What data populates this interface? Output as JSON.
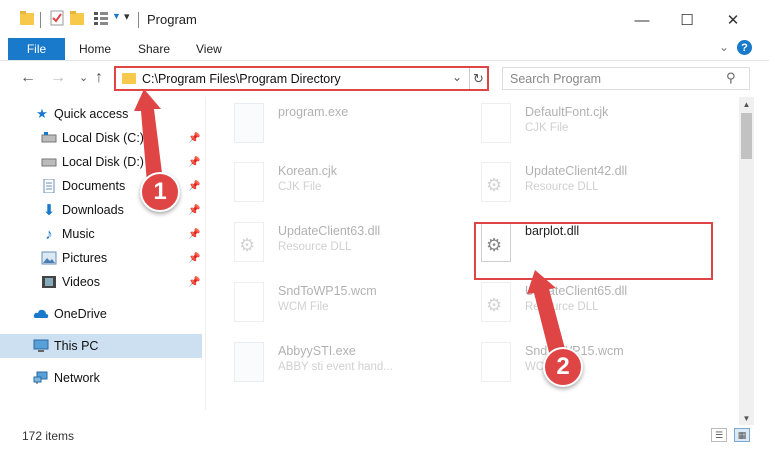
{
  "window": {
    "title": "Program",
    "minimize": "—",
    "maximize": "☐",
    "close": "✕"
  },
  "ribbon": {
    "tabs": [
      "File",
      "Home",
      "Share",
      "View"
    ],
    "collapse": "⌄",
    "help": "?"
  },
  "nav": {
    "back": "←",
    "forward": "→",
    "recent": "⌄",
    "up": "↑",
    "address": "C:\\Program Files\\Program Directory",
    "address_dropdown": "⌄",
    "refresh": "↻",
    "search_placeholder": "Search Program",
    "search_icon": "⚲"
  },
  "sidebar": {
    "items": [
      {
        "label": "Quick access",
        "icon": "star-icon"
      },
      {
        "label": "Local Disk (C:)",
        "icon": "drive-icon"
      },
      {
        "label": "Local Disk (D:)",
        "icon": "drive-icon"
      },
      {
        "label": "Documents",
        "icon": "documents-icon"
      },
      {
        "label": "Downloads",
        "icon": "download-icon"
      },
      {
        "label": "Music",
        "icon": "music-icon"
      },
      {
        "label": "Pictures",
        "icon": "pictures-icon"
      },
      {
        "label": "Videos",
        "icon": "videos-icon"
      },
      {
        "label": "OneDrive",
        "icon": "cloud-icon"
      },
      {
        "label": "This PC",
        "icon": "computer-icon"
      },
      {
        "label": "Network",
        "icon": "network-icon"
      }
    ]
  },
  "files": [
    {
      "name": "program.exe",
      "type": ""
    },
    {
      "name": "DefaultFont.cjk",
      "type": "CJK File"
    },
    {
      "name": "Korean.cjk",
      "type": "CJK File"
    },
    {
      "name": "UpdateClient42.dll",
      "type": "Resource DLL"
    },
    {
      "name": "UpdateClient63.dll",
      "type": "Resource DLL"
    },
    {
      "name": "barplot.dll",
      "type": ""
    },
    {
      "name": "SndToWP15.wcm",
      "type": "WCM File"
    },
    {
      "name": "UpdateClient65.dll",
      "type": "Resource DLL"
    },
    {
      "name": "AbbyySTI.exe",
      "type": "ABBY sti event hand..."
    },
    {
      "name": "SndToWP15.wcm",
      "type": "WCM File"
    }
  ],
  "status": {
    "item_count": "172 items"
  },
  "annotations": {
    "step1": "1",
    "step2": "2"
  },
  "colors": {
    "accent": "#1979ca",
    "highlight": "#e04545",
    "selected": "#cce0f2"
  }
}
